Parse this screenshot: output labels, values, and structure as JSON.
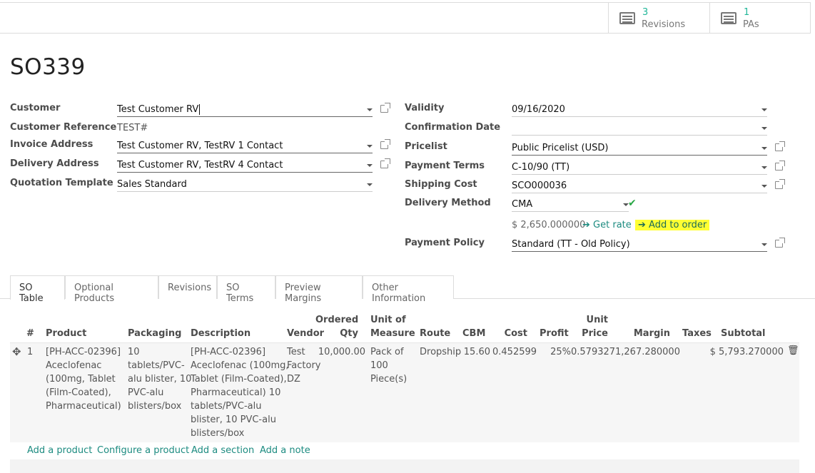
{
  "stat_buttons": [
    {
      "count": "3",
      "label": "Revisions",
      "icon": "list-icon"
    },
    {
      "count": "1",
      "label": "PAs",
      "icon": "list-icon"
    }
  ],
  "record_title": "SO339",
  "left_fields": {
    "customer": {
      "label": "Customer",
      "value": "Test Customer RV"
    },
    "customer_reference": {
      "label": "Customer Reference",
      "value": "TEST#"
    },
    "invoice_address": {
      "label": "Invoice Address",
      "value": "Test Customer RV, TestRV 1 Contact"
    },
    "delivery_address": {
      "label": "Delivery Address",
      "value": "Test Customer RV, TestRV 4 Contact"
    },
    "quotation_template": {
      "label": "Quotation Template",
      "value": "Sales Standard"
    }
  },
  "right_fields": {
    "validity": {
      "label": "Validity",
      "value": "09/16/2020"
    },
    "confirmation_date": {
      "label": "Confirmation Date",
      "value": ""
    },
    "pricelist": {
      "label": "Pricelist",
      "value": "Public Pricelist (USD)"
    },
    "payment_terms": {
      "label": "Payment Terms",
      "value": "C-10/90 (TT)"
    },
    "shipping_cost": {
      "label": "Shipping Cost",
      "value": "SCO000036"
    },
    "delivery_method": {
      "label": "Delivery Method",
      "value": "CMA"
    },
    "rate_amount": "$ 2,650.000000",
    "get_rate": "Get rate",
    "add_to_order": "Add to order",
    "payment_policy": {
      "label": "Payment Policy",
      "value": "Standard (TT - Old Policy)"
    }
  },
  "tabs": [
    "SO Table",
    "Optional Products",
    "Revisions",
    "SO Terms",
    "Preview Margins",
    "Other Information"
  ],
  "table": {
    "headers": {
      "num": "#",
      "product": "Product",
      "packaging": "Packaging",
      "description": "Description",
      "vendor": "Vendor",
      "ordered_qty_1": "Ordered",
      "ordered_qty_2": "Qty",
      "uom_1": "Unit of",
      "uom_2": "Measure",
      "route": "Route",
      "cbm": "CBM",
      "cost": "Cost",
      "profit": "Profit",
      "unit_price_1": "Unit",
      "unit_price_2": "Price",
      "margin": "Margin",
      "taxes": "Taxes",
      "subtotal": "Subtotal"
    },
    "rows": [
      {
        "num": "1",
        "product": [
          "[PH-ACC-02396]",
          "Aceclofenac",
          "(100mg, Tablet",
          "(Film-Coated),",
          "Pharmaceutical)"
        ],
        "packaging": [
          "10",
          "tablets/PVC-",
          "alu blister, 10",
          "PVC-alu",
          "blisters/box"
        ],
        "description": [
          "[PH-ACC-02396]",
          "Aceclofenac (100mg,",
          "Tablet (Film-Coated),",
          "Pharmaceutical) 10",
          "tablets/PVC-alu",
          "blister, 10 PVC-alu",
          "blisters/box"
        ],
        "vendor": [
          "Test",
          "Factory",
          "DZ"
        ],
        "ordered_qty": "10,000.00",
        "uom": [
          "Pack of",
          "100",
          "Piece(s)"
        ],
        "route": "Dropship",
        "cbm": "15.60",
        "cost": "0.452599",
        "profit": "25%",
        "unit_price": "0.579327",
        "margin": "1,267.280000",
        "taxes": "",
        "subtotal": "$ 5,793.270000"
      }
    ]
  },
  "footer_links": [
    "Add a product",
    "Configure a product",
    "Add a section",
    "Add a note"
  ]
}
